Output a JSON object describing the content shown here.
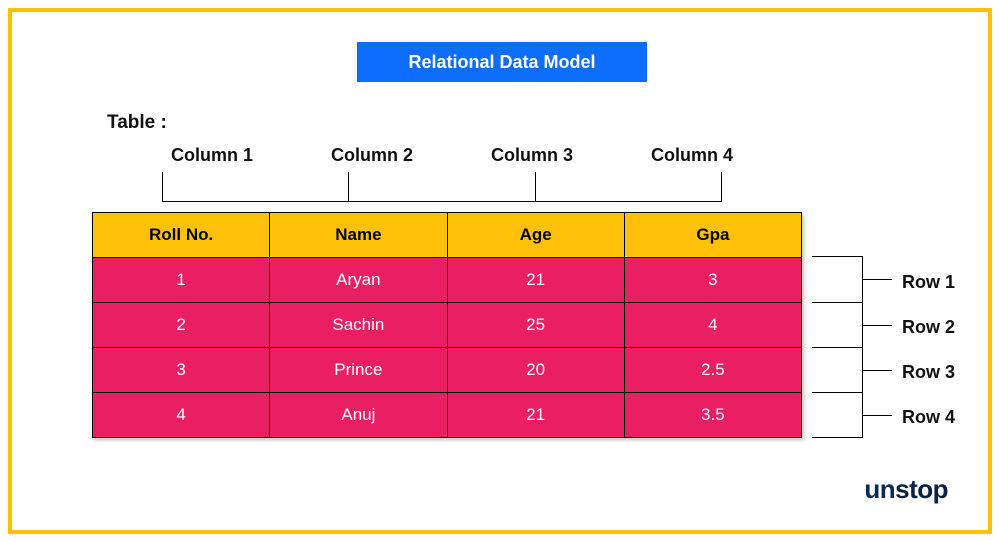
{
  "title": "Relational Data Model",
  "tableLabel": "Table :",
  "columnLabels": [
    "Column 1",
    "Column 2",
    "Column 3",
    "Column 4"
  ],
  "rowLabels": [
    "Row 1",
    "Row 2",
    "Row 3",
    "Row 4"
  ],
  "headers": [
    "Roll No.",
    "Name",
    "Age",
    "Gpa"
  ],
  "rows": [
    {
      "rollNo": "1",
      "name": "Aryan",
      "age": "21",
      "gpa": "3"
    },
    {
      "rollNo": "2",
      "name": "Sachin",
      "age": "25",
      "gpa": "4"
    },
    {
      "rollNo": "3",
      "name": "Prince",
      "age": "20",
      "gpa": "2.5"
    },
    {
      "rollNo": "4",
      "name": "Anuj",
      "age": "21",
      "gpa": "3.5"
    }
  ],
  "logo": {
    "part1": "un",
    "part2": "stop"
  },
  "colors": {
    "frame": "#ffc107",
    "titleBg": "#0d6efd",
    "headerBg": "#ffc107",
    "rowBg": "#e91e63",
    "text": "#111"
  },
  "chart_data": {
    "type": "table",
    "title": "Relational Data Model",
    "columns": [
      "Roll No.",
      "Name",
      "Age",
      "Gpa"
    ],
    "data": [
      [
        1,
        "Aryan",
        21,
        3
      ],
      [
        2,
        "Sachin",
        25,
        4
      ],
      [
        3,
        "Prince",
        20,
        2.5
      ],
      [
        4,
        "Anuj",
        21,
        3.5
      ]
    ]
  }
}
